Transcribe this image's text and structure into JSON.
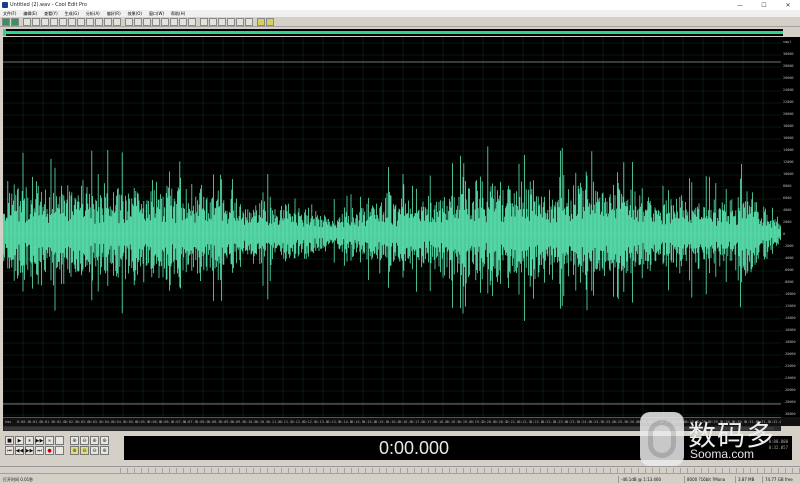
{
  "window": {
    "title": "Untitled (2).wav - Cool Edit Pro",
    "controls": [
      "—",
      "☐",
      "✕"
    ]
  },
  "menu": [
    "文件(F)",
    "编辑(E)",
    "查看(Y)",
    "生成(G)",
    "分析(A)",
    "偏好(R)",
    "效果(O)",
    "窗口(W)",
    "帮助(H)"
  ],
  "toolbar": {
    "buttons": [
      "track-view",
      "wave-view",
      "new",
      "open",
      "save",
      "undo",
      "redo",
      "cut",
      "copy",
      "paste",
      "mix-paste",
      "crop",
      "silence",
      "zoom-in",
      "zoom-out",
      "spectral",
      "settings",
      "loop",
      "scan",
      "cue",
      "play-list",
      "metronome",
      "record-level",
      "wave-1",
      "wave-2",
      "wave-3",
      "wave-4",
      "multi-1",
      "multi-2"
    ]
  },
  "waveform": {
    "color": "#5ce8b2",
    "background": "#000000",
    "db_scale": [
      "smpl",
      "30000",
      "28000",
      "26000",
      "24000",
      "22000",
      "20000",
      "18000",
      "16000",
      "14000",
      "12000",
      "10000",
      "8000",
      "6000",
      "4000",
      "2000",
      "0",
      "-2000",
      "-4000",
      "-6000",
      "-8000",
      "-10000",
      "-12000",
      "-14000",
      "-16000",
      "-18000",
      "-20000",
      "-22000",
      "-24000",
      "-26000",
      "-28000",
      "-30000"
    ],
    "time_labels": [
      "hms",
      "0:00.5",
      "0:01.0",
      "0:01.5",
      "0:02.0",
      "0:02.5",
      "0:03.0",
      "0:03.5",
      "0:04.0",
      "0:04.5",
      "0:05.0",
      "0:05.5",
      "0:06.0",
      "0:06.5",
      "0:07.0",
      "0:07.5",
      "0:08.0",
      "0:08.5",
      "0:09.0",
      "0:09.5",
      "0:10.0",
      "0:10.5",
      "0:11.0",
      "0:11.5",
      "0:12.0",
      "0:12.5",
      "0:13.0",
      "0:13.5",
      "0:14.0",
      "0:14.5",
      "0:15.0",
      "0:15.5",
      "0:16.0",
      "0:16.5",
      "0:17.0",
      "0:17.5",
      "0:18.0",
      "0:18.5",
      "0:19.0",
      "0:19.5",
      "0:20.0",
      "0:20.5",
      "0:21.0",
      "0:21.5",
      "0:22.0",
      "0:22.5",
      "0:23.0",
      "0:23.5",
      "0:24.0",
      "0:24.5",
      "0:25.0",
      "0:25.5",
      "0:26.0",
      "0:26.5",
      "0:27.0",
      "0:27.5",
      "0:28.0",
      "0:28.5",
      "0:29.0",
      "0:29.5",
      "0:30.0",
      "0:30.5",
      "0:31.0",
      "0:31.5",
      "0:32.0"
    ]
  },
  "transport": {
    "buttons": [
      "■",
      "▶",
      "⏸",
      "▶▶",
      "∞",
      "⏮",
      "◀◀",
      "▶▶",
      "⏭",
      "●"
    ],
    "zoom_buttons": [
      "⊕",
      "⊖",
      "⊕",
      "⊕",
      "⊕",
      "⊖",
      "⊖",
      "⊕"
    ],
    "time_display": "0:00.000",
    "side_info": [
      "0:00.000",
      "0:32.057"
    ]
  },
  "statusbar": {
    "open_time": "打开时间 0.01秒",
    "level": "-46.1dB @ 1:13.460",
    "format": "8000 ?16bit ?Mono",
    "size": "3.87 MB",
    "free": "74.77 GB free"
  },
  "watermark": {
    "cn": "数码多",
    "en": "Sooma.com"
  }
}
